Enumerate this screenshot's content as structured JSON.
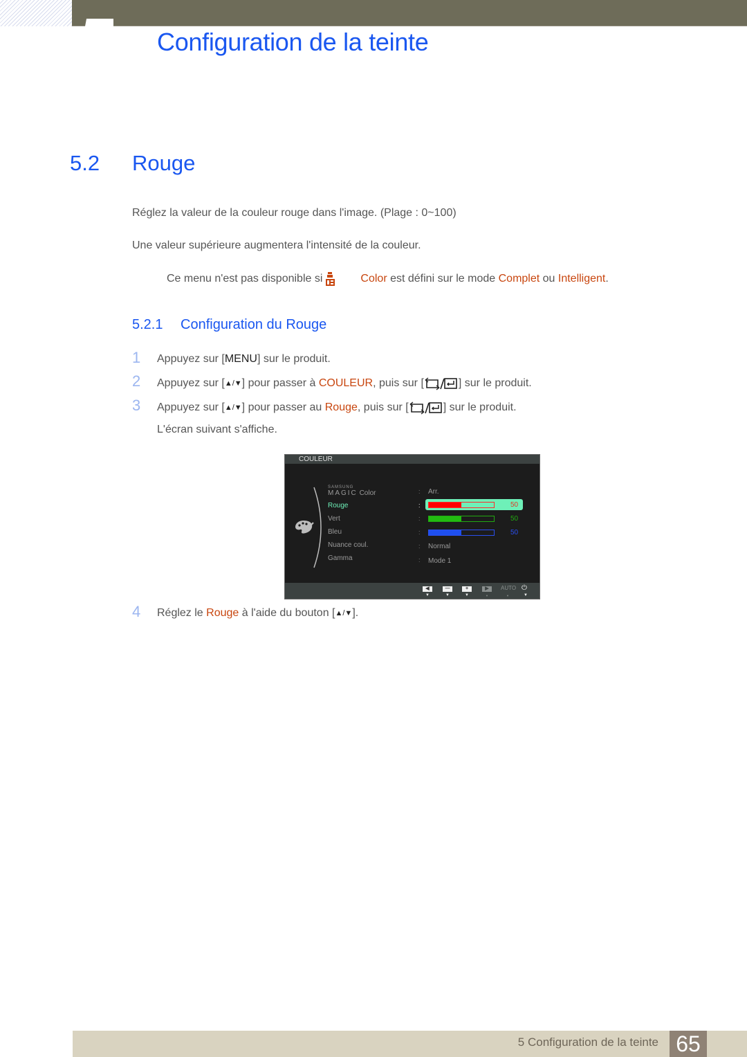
{
  "header": {
    "chapter_title": "Configuration de la teinte"
  },
  "section": {
    "number": "5.2",
    "title": "Rouge"
  },
  "paragraphs": [
    "Réglez la valeur de la couleur rouge dans l'image. (Plage : 0~100)",
    "Une valeur supérieure augmentera l'intensité de la couleur."
  ],
  "note": {
    "prefix": "Ce menu n'est pas disponible si",
    "icon": "samsung-magic-icon",
    "hl1": "Color",
    "mid": " est défini sur le mode ",
    "hl2": "Complet",
    "mid2": " ou ",
    "hl3": "Intelligent",
    "suffix": "."
  },
  "subsection": {
    "number": "5.2.1",
    "title": "Configuration du Rouge"
  },
  "steps": [
    {
      "num": "1",
      "a": "Appuyez sur [",
      "key": "MENU",
      "b": "] sur le produit."
    },
    {
      "num": "2",
      "a": "Appuyez sur [",
      "updown": "▲/▼",
      "b": "] pour passer à ",
      "hl": "COULEUR",
      "c": ", puis sur [",
      "d": "] sur le produit."
    },
    {
      "num": "3",
      "a": "Appuyez sur [",
      "updown": "▲/▼",
      "b": "] pour passer au ",
      "hl": "Rouge",
      "c": ", puis sur [",
      "d": "] sur le produit.",
      "line2": "L'écran suivant s'affiche."
    },
    {
      "num": "4",
      "a": "Réglez le ",
      "hl": "Rouge",
      "b": " à l'aide du bouton [",
      "updown": "▲/▼",
      "c": "]."
    }
  ],
  "osd": {
    "header": "COULEUR",
    "samsung": "SAMSUNG",
    "magic": "MAGIC",
    "items": [
      {
        "label": "Color",
        "value": "Arr."
      },
      {
        "label": "Rouge",
        "value": 50,
        "active": true,
        "color": "#ff0000",
        "fill": 0.5
      },
      {
        "label": "Vert",
        "value": 50,
        "color": "#22bb11",
        "fill": 0.5
      },
      {
        "label": "Bleu",
        "value": 50,
        "color": "#1e4ff0",
        "fill": 0.5
      },
      {
        "label": "Nuance coul.",
        "value": "Normal"
      },
      {
        "label": "Gamma",
        "value": "Mode 1"
      }
    ],
    "footer": {
      "auto": "AUTO"
    }
  },
  "footer": {
    "chapter": "5 Configuration de la teinte",
    "page": "65"
  },
  "colors": {
    "accent_blue": "#1a57f0",
    "highlight_orange": "#c8460f",
    "top_bar": "#6e6c59",
    "footer_bar": "#d9d3c0",
    "page_badge": "#8f8275",
    "osd_active": "#6ef0b8"
  }
}
